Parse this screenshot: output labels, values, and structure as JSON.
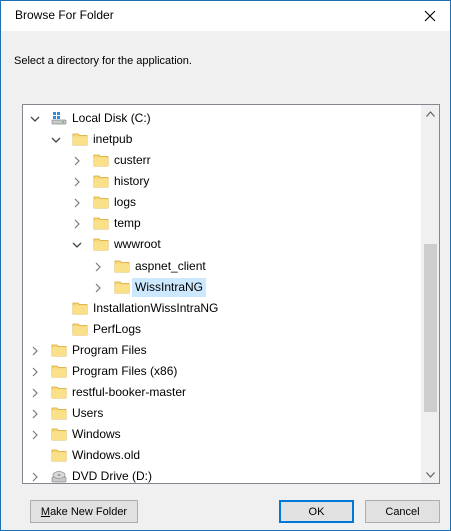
{
  "dialog": {
    "title": "Browse For Folder",
    "instruction": "Select a directory for the application."
  },
  "tree": {
    "items": [
      {
        "label": "Local Disk (C:)",
        "icon": "local-disk-icon",
        "expander": "expanded"
      },
      {
        "label": "inetpub",
        "icon": "folder-icon",
        "expander": "expanded"
      },
      {
        "label": "custerr",
        "icon": "folder-icon",
        "expander": "collapsed"
      },
      {
        "label": "history",
        "icon": "folder-icon",
        "expander": "collapsed"
      },
      {
        "label": "logs",
        "icon": "folder-icon",
        "expander": "collapsed"
      },
      {
        "label": "temp",
        "icon": "folder-icon",
        "expander": "collapsed"
      },
      {
        "label": "wwwroot",
        "icon": "folder-icon",
        "expander": "expanded"
      },
      {
        "label": "aspnet_client",
        "icon": "folder-icon",
        "expander": "collapsed"
      },
      {
        "label": "WissIntraNG",
        "icon": "folder-icon",
        "expander": "collapsed",
        "selected": true
      },
      {
        "label": "InstallationWissIntraNG",
        "icon": "folder-icon",
        "expander": "none"
      },
      {
        "label": "PerfLogs",
        "icon": "folder-icon",
        "expander": "none"
      },
      {
        "label": "Program Files",
        "icon": "folder-icon",
        "expander": "collapsed"
      },
      {
        "label": "Program Files (x86)",
        "icon": "folder-icon",
        "expander": "collapsed"
      },
      {
        "label": "restful-booker-master",
        "icon": "folder-icon",
        "expander": "collapsed"
      },
      {
        "label": "Users",
        "icon": "folder-icon",
        "expander": "collapsed"
      },
      {
        "label": "Windows",
        "icon": "folder-icon",
        "expander": "collapsed"
      },
      {
        "label": "Windows.old",
        "icon": "folder-icon",
        "expander": "none"
      },
      {
        "label": "DVD Drive (D:)",
        "icon": "dvd-drive-icon",
        "expander": "collapsed"
      }
    ]
  },
  "buttons": {
    "make_new_folder_first": "M",
    "make_new_folder_rest": "ake New Folder",
    "ok": "OK",
    "cancel": "Cancel"
  },
  "colors": {
    "selection": "#cce8ff",
    "folder": "#f8d775",
    "accent_border": "#0078d7"
  }
}
